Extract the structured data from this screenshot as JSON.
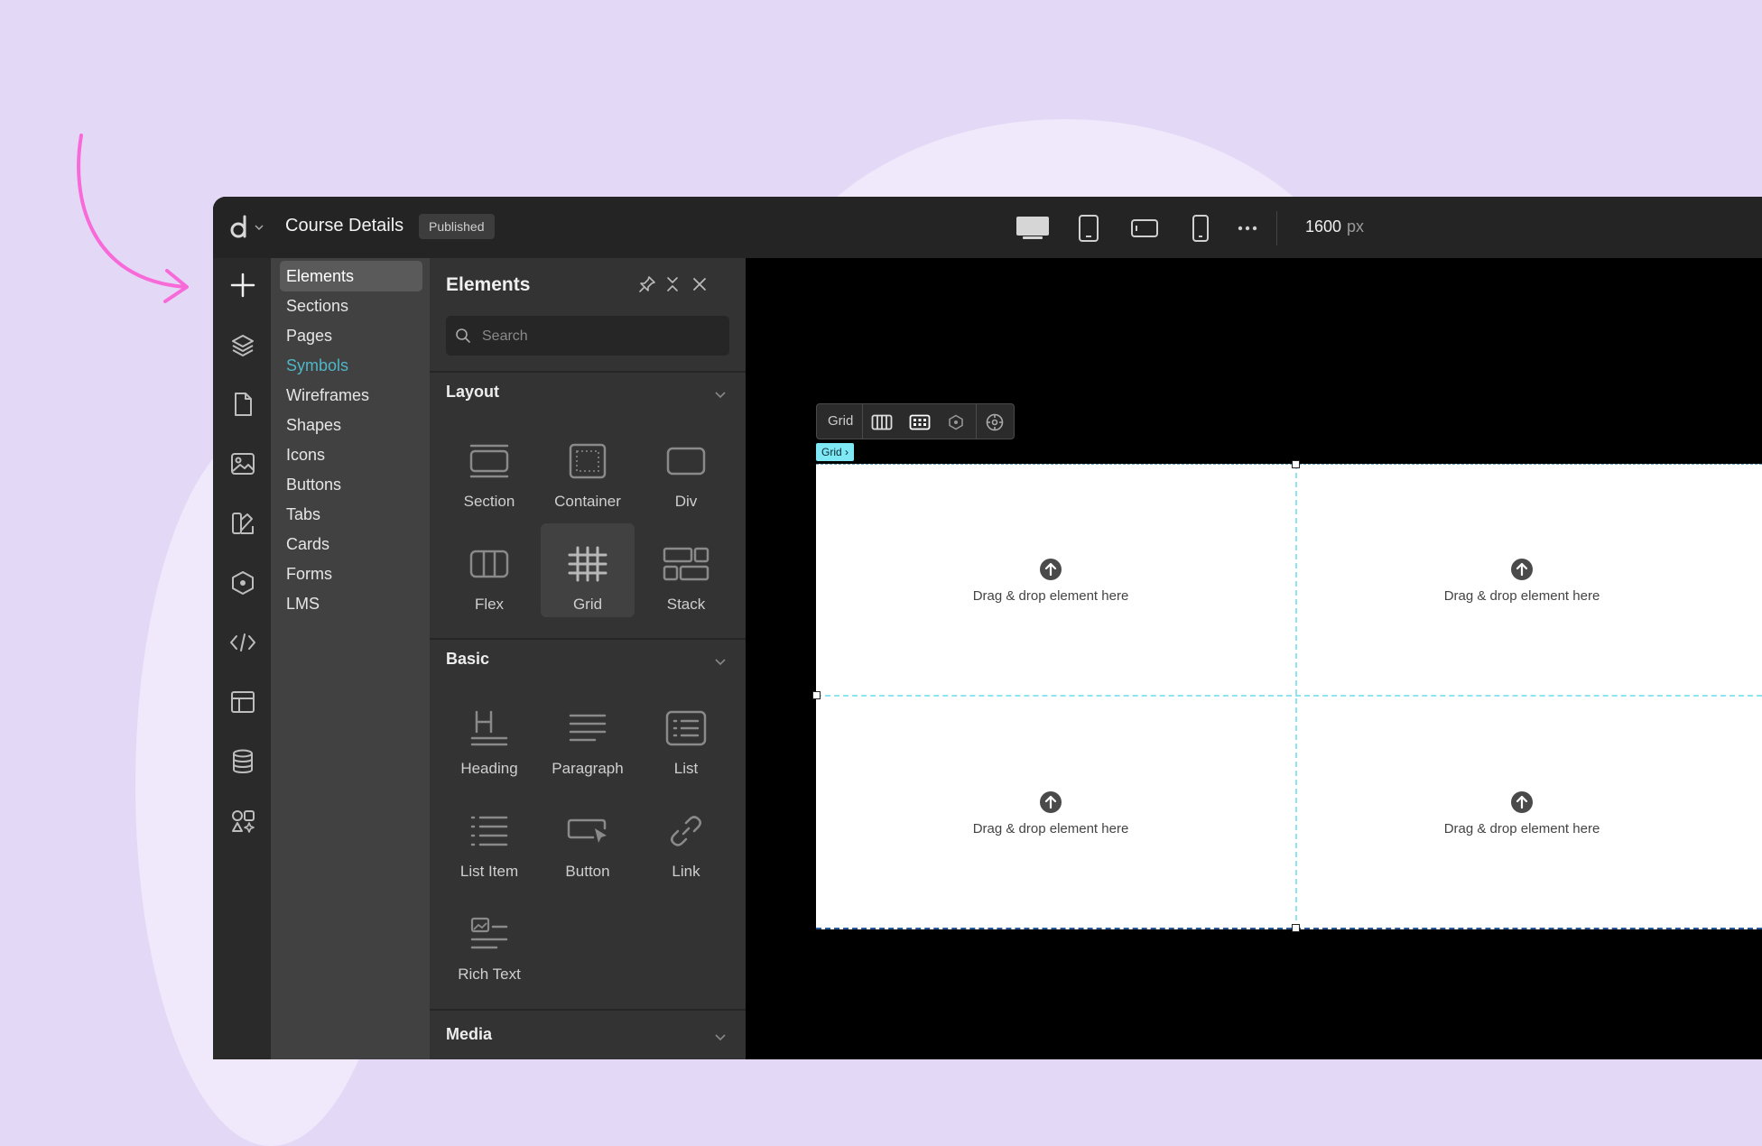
{
  "window": {
    "app_title": "Course Details",
    "status_badge": "Published",
    "viewport_width": "1600",
    "viewport_unit": "px",
    "devices": [
      {
        "name": "desktop-icon",
        "active": true
      },
      {
        "name": "tablet-icon",
        "active": false
      },
      {
        "name": "tablet-landscape-icon",
        "active": false
      },
      {
        "name": "mobile-icon",
        "active": false
      }
    ]
  },
  "categories": [
    {
      "label": "Elements",
      "state": "active"
    },
    {
      "label": "Sections",
      "state": "normal"
    },
    {
      "label": "Pages",
      "state": "normal"
    },
    {
      "label": "Symbols",
      "state": "accent"
    },
    {
      "label": "Wireframes",
      "state": "normal"
    },
    {
      "label": "Shapes",
      "state": "normal"
    },
    {
      "label": "Icons",
      "state": "normal"
    },
    {
      "label": "Buttons",
      "state": "normal"
    },
    {
      "label": "Tabs",
      "state": "normal"
    },
    {
      "label": "Cards",
      "state": "normal"
    },
    {
      "label": "Forms",
      "state": "normal"
    },
    {
      "label": "LMS",
      "state": "normal"
    }
  ],
  "panel": {
    "title": "Elements",
    "search_placeholder": "Search",
    "sections": [
      {
        "title": "Layout",
        "items": [
          "Section",
          "Container",
          "Div",
          "Flex",
          "Grid",
          "Stack"
        ],
        "selected": "Grid"
      },
      {
        "title": "Basic",
        "items": [
          "Heading",
          "Paragraph",
          "List",
          "List Item",
          "Button",
          "Link",
          "Rich Text"
        ]
      },
      {
        "title": "Media"
      }
    ]
  },
  "canvas": {
    "grid_toolbar_label": "Grid",
    "grid_tag": "Grid",
    "cells": [
      "Drag & drop element here",
      "Drag & drop element here",
      "Drag & drop element here",
      "Drag & drop element here"
    ]
  },
  "colors": {
    "background": "#e3d9f7",
    "accent_arrow": "#f76ad8",
    "accent_text": "#4fb6c7",
    "grid_guide": "#8fe4f1"
  }
}
